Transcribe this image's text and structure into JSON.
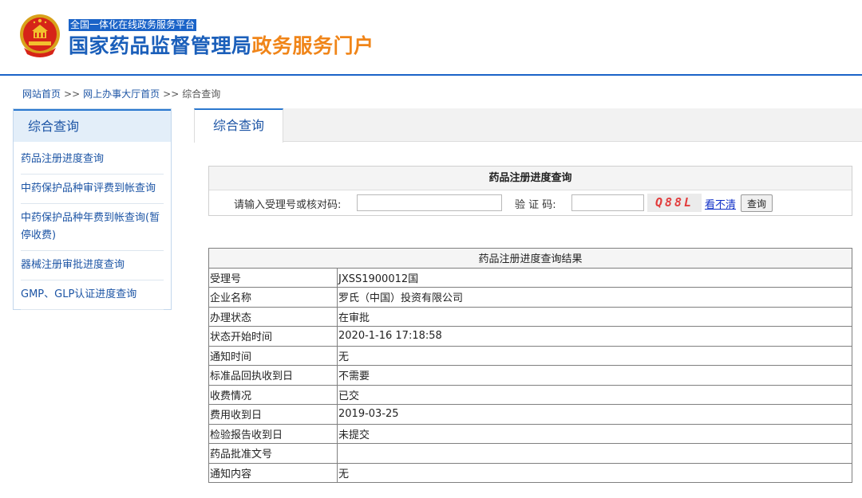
{
  "header": {
    "platform_tag": "全国一体化在线政务服务平台",
    "title_main": "国家药品监督管理局",
    "title_accent": "政务服务门户",
    "colors": {
      "blue": "#1b5fba",
      "orange": "#f08519"
    }
  },
  "breadcrumb": {
    "items": [
      "网站首页",
      "网上办事大厅首页",
      "综合查询"
    ],
    "separator": ">>"
  },
  "sidebar": {
    "title": "综合查询",
    "items": [
      {
        "label": "药品注册进度查询"
      },
      {
        "label": "中药保护品种审评费到帐查询"
      },
      {
        "label": "中药保护品种年费到帐查询(暂停收费)"
      },
      {
        "label": "器械注册审批进度查询"
      },
      {
        "label": "GMP、GLP认证进度查询"
      }
    ]
  },
  "tabs": [
    {
      "label": "综合查询"
    }
  ],
  "query": {
    "title": "药品注册进度查询",
    "label_number": "请输入受理号或核对码:",
    "label_captcha": "验 证 码:",
    "captcha_text": "Q88L",
    "refresh_label": "看不清",
    "submit_label": "查询"
  },
  "result": {
    "title": "药品注册进度查询结果",
    "rows": [
      {
        "key": "受理号",
        "value": "JXSS1900012国"
      },
      {
        "key": "企业名称",
        "value": "罗氏（中国）投资有限公司"
      },
      {
        "key": "办理状态",
        "value": "在审批"
      },
      {
        "key": "状态开始时间",
        "value": "2020-1-16 17:18:58"
      },
      {
        "key": "通知时间",
        "value": "无"
      },
      {
        "key": "标准品回执收到日",
        "value": "不需要"
      },
      {
        "key": "收费情况",
        "value": "已交"
      },
      {
        "key": "费用收到日",
        "value": "2019-03-25"
      },
      {
        "key": "检验报告收到日",
        "value": "未提交"
      },
      {
        "key": "药品批准文号",
        "value": ""
      },
      {
        "key": "通知内容",
        "value": "无"
      }
    ]
  }
}
